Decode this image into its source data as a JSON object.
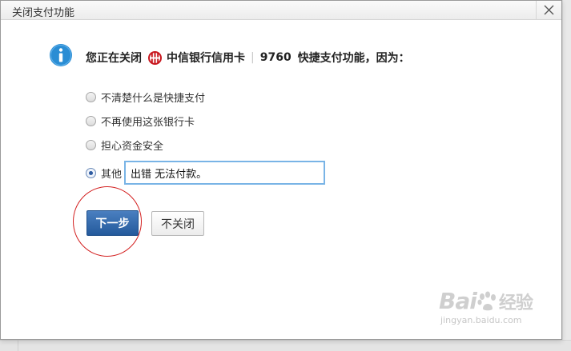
{
  "dialog": {
    "title": "关闭支付功能",
    "close_glyph": "✕"
  },
  "headline": {
    "prefix": "您正在关闭",
    "bank_name": "中信银行信用卡",
    "separator": "|",
    "card_last4": "9760",
    "suffix": "快捷支付功能，因为："
  },
  "options": [
    {
      "label": "不清楚什么是快捷支付",
      "checked": false
    },
    {
      "label": "不再使用这张银行卡",
      "checked": false
    },
    {
      "label": "担心资金安全",
      "checked": false
    },
    {
      "label": "其他",
      "checked": true
    }
  ],
  "other_input": {
    "value": "出错 无法付款。"
  },
  "buttons": {
    "next": "下一步",
    "no_close": "不关闭"
  },
  "watermark": {
    "logo_text": "Bai",
    "logo_text2": "经验",
    "url": "jingyan.baidu.com"
  },
  "colors": {
    "primary_button": "#2d64a8",
    "info_icon": "#2a8dd4",
    "bank_logo": "#c8161d",
    "annotation_circle": "#d32020",
    "input_focus_border": "#79b4e6"
  },
  "icons": {
    "info": "info-icon",
    "bank": "citic-bank-logo-icon",
    "close": "close-icon"
  }
}
